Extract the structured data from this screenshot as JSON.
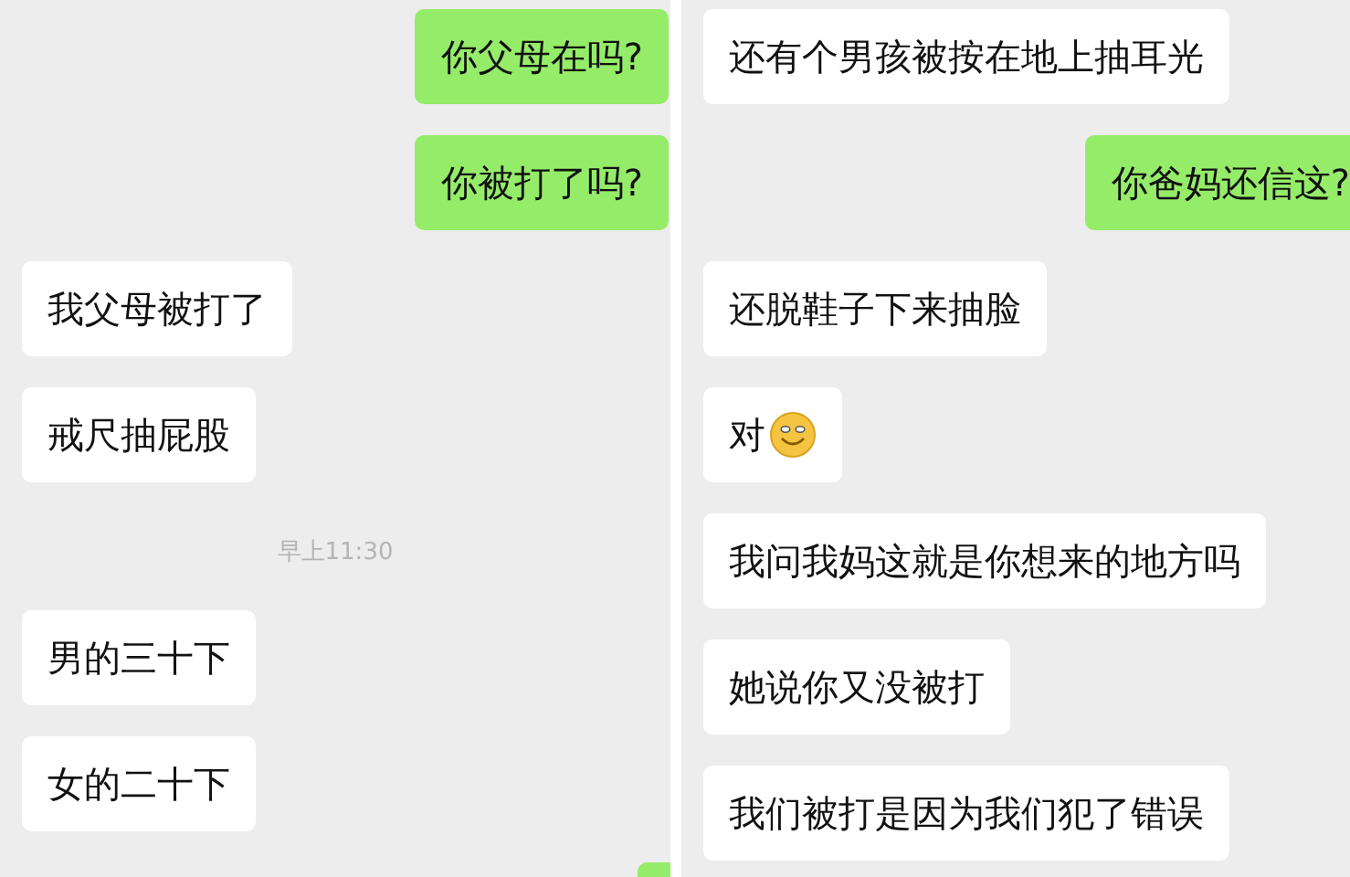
{
  "panels": [
    {
      "messages": [
        {
          "kind": "sent",
          "text": "你父母在吗?",
          "emoji": false
        },
        {
          "kind": "sent",
          "text": "你被打了吗?",
          "emoji": false
        },
        {
          "kind": "received",
          "text": "我父母被打了",
          "emoji": false
        },
        {
          "kind": "received",
          "text": "戒尺抽屁股",
          "emoji": false
        },
        {
          "kind": "time",
          "text": "早上11:30"
        },
        {
          "kind": "received",
          "text": "男的三十下",
          "emoji": false
        },
        {
          "kind": "received",
          "text": "女的二十下",
          "emoji": false
        },
        {
          "kind": "sent_partial"
        }
      ]
    },
    {
      "messages": [
        {
          "kind": "received",
          "text": "还有个男孩被按在地上抽耳光",
          "emoji": false
        },
        {
          "kind": "sent_cut",
          "text": "你爸妈还信这?",
          "emoji": false
        },
        {
          "kind": "received",
          "text": "还脱鞋子下来抽脸",
          "emoji": false
        },
        {
          "kind": "received",
          "text": "对",
          "emoji": true
        },
        {
          "kind": "received",
          "text": "我问我妈这就是你想来的地方吗",
          "emoji": false
        },
        {
          "kind": "received",
          "text": "她说你又没被打",
          "emoji": false
        },
        {
          "kind": "received",
          "text": "我们被打是因为我们犯了错误",
          "emoji": false
        }
      ]
    }
  ]
}
